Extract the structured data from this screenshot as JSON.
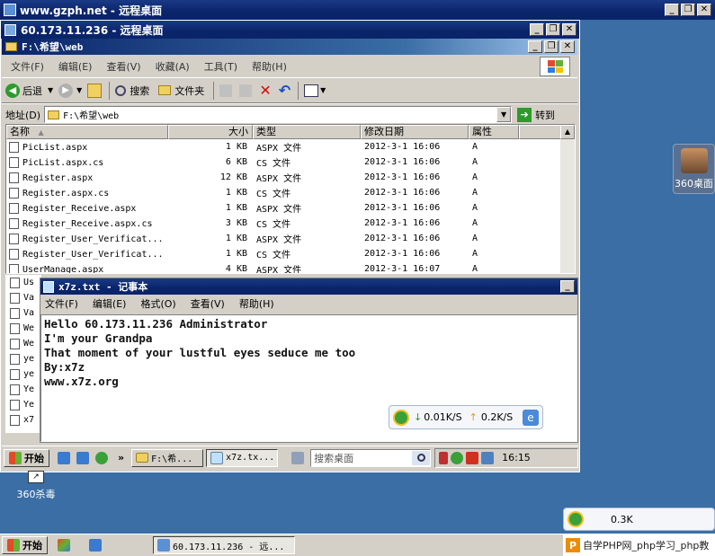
{
  "outer_window": {
    "title": "www.gzph.net - 远程桌面"
  },
  "rdp_window": {
    "title": "60.173.11.236 - 远程桌面"
  },
  "explorer": {
    "title": "F:\\希望\\web",
    "menu": [
      "文件(F)",
      "编辑(E)",
      "查看(V)",
      "收藏(A)",
      "工具(T)",
      "帮助(H)"
    ],
    "toolbar": {
      "back": "后退",
      "search": "搜索",
      "folders": "文件夹"
    },
    "address": {
      "label": "地址(D)",
      "value": "F:\\希望\\web",
      "go": "转到"
    },
    "columns": {
      "name": "名称",
      "size": "大小",
      "type": "类型",
      "modified": "修改日期",
      "attr": "属性"
    },
    "files": [
      {
        "name": "PicList.aspx",
        "size": "1 KB",
        "type": "ASPX 文件",
        "modified": "2012-3-1 16:06",
        "attr": "A"
      },
      {
        "name": "PicList.aspx.cs",
        "size": "6 KB",
        "type": "CS 文件",
        "modified": "2012-3-1 16:06",
        "attr": "A"
      },
      {
        "name": "Register.aspx",
        "size": "12 KB",
        "type": "ASPX 文件",
        "modified": "2012-3-1 16:06",
        "attr": "A"
      },
      {
        "name": "Register.aspx.cs",
        "size": "1 KB",
        "type": "CS 文件",
        "modified": "2012-3-1 16:06",
        "attr": "A"
      },
      {
        "name": "Register_Receive.aspx",
        "size": "1 KB",
        "type": "ASPX 文件",
        "modified": "2012-3-1 16:06",
        "attr": "A"
      },
      {
        "name": "Register_Receive.aspx.cs",
        "size": "3 KB",
        "type": "CS 文件",
        "modified": "2012-3-1 16:06",
        "attr": "A"
      },
      {
        "name": "Register_User_Verificat...",
        "size": "1 KB",
        "type": "ASPX 文件",
        "modified": "2012-3-1 16:06",
        "attr": "A"
      },
      {
        "name": "Register_User_Verificat...",
        "size": "1 KB",
        "type": "CS 文件",
        "modified": "2012-3-1 16:06",
        "attr": "A"
      },
      {
        "name": "UserManage.aspx",
        "size": "4 KB",
        "type": "ASPX 文件",
        "modified": "2012-3-1 16:07",
        "attr": "A"
      }
    ],
    "hidden_rows": [
      "Us",
      "Va",
      "Va",
      "We",
      "We",
      "ye",
      "ye",
      "Ye",
      "Ye",
      "x7"
    ]
  },
  "notepad": {
    "title": "x7z.txt - 记事本",
    "menu": [
      "文件(F)",
      "编辑(E)",
      "格式(O)",
      "查看(V)",
      "帮助(H)"
    ],
    "lines": [
      "Hello 60.173.11.236 Administrator",
      "I'm your Grandpa",
      "That moment of your lustful eyes seduce me too",
      "By:x7z",
      "www.x7z.org"
    ]
  },
  "net_widget": {
    "down": "0.01K/S",
    "up": "0.2K/S"
  },
  "inner_taskbar": {
    "start": "开始",
    "tasks": [
      "F:\\希...",
      "x7z.tx..."
    ],
    "search_placeholder": "搜索桌面",
    "time": "16:15"
  },
  "desktop": {
    "icon_360desk": "360桌面",
    "icon_360av": "360杀毒"
  },
  "outer_taskbar": {
    "start": "开始",
    "task": "60.173.11.236 - 远...",
    "net_partial": "0.3K"
  },
  "watermark": {
    "text": "自学PHP网_php学习_php教"
  },
  "colors": {
    "title_active": "#0a246a",
    "desktop": "#3a6ea5",
    "face": "#d4d0c8"
  }
}
